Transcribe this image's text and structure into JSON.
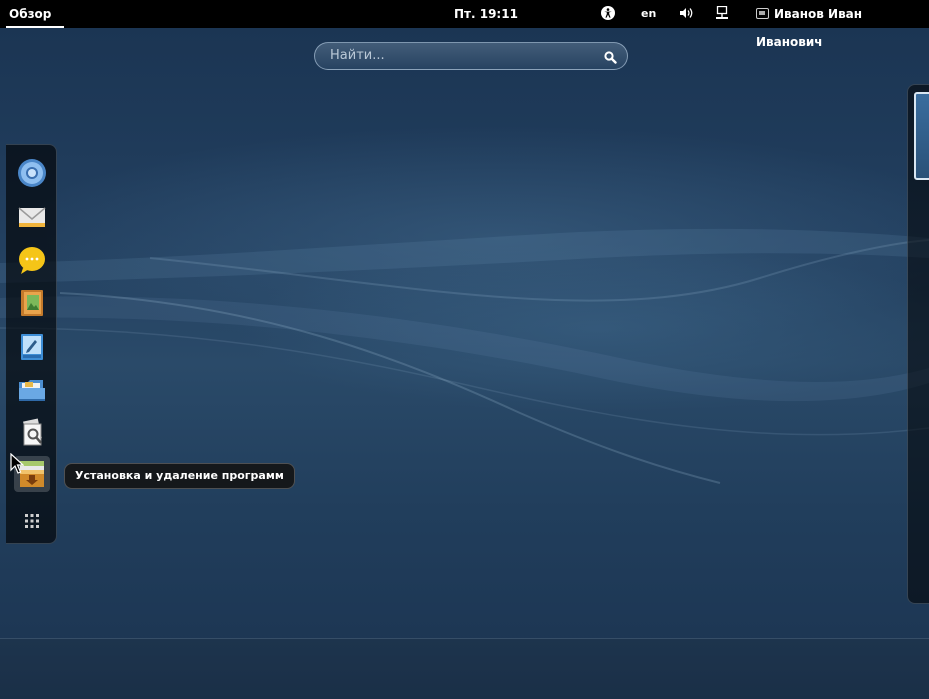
{
  "topbar": {
    "activities_label": "Обзор",
    "clock": "Пт. 19:11",
    "accessibility_icon": "accessibility-icon",
    "keyboard_layout": "en",
    "volume_icon": "volume-icon",
    "network_icon": "network-wired-icon",
    "user_name": "Иванов Иван Иванович"
  },
  "search": {
    "placeholder": "Найти...",
    "icon": "search-icon"
  },
  "dash": {
    "items": [
      {
        "name": "chromium-browser",
        "icon": "browser-icon"
      },
      {
        "name": "mail-client",
        "icon": "mail-icon"
      },
      {
        "name": "instant-messenger",
        "icon": "chat-icon"
      },
      {
        "name": "photo-manager",
        "icon": "photo-book-icon"
      },
      {
        "name": "text-editor",
        "icon": "text-editor-icon"
      },
      {
        "name": "file-manager",
        "icon": "folder-icon"
      },
      {
        "name": "document-viewer",
        "icon": "document-viewer-icon"
      },
      {
        "name": "software-install",
        "icon": "package-install-icon"
      }
    ],
    "show_apps_icon": "grid-icon",
    "tooltip": "Установка и удаление программ"
  },
  "colors": {
    "topbar": "#000000",
    "wallpaper": "#223f5f",
    "dash_background": "#000000"
  }
}
